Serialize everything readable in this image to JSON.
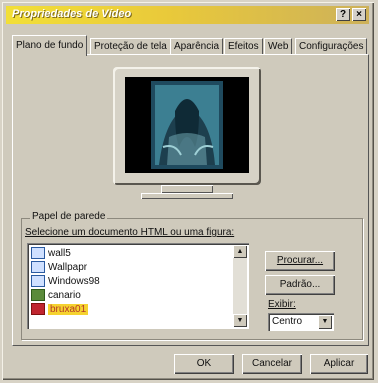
{
  "window": {
    "title": "Propriedades de Vídeo",
    "help_button": "?",
    "close_button": "×"
  },
  "tabs": [
    {
      "label": "Plano de fundo",
      "active": true
    },
    {
      "label": "Proteção de tela",
      "active": false
    },
    {
      "label": "Aparência",
      "active": false
    },
    {
      "label": "Efeitos",
      "active": false
    },
    {
      "label": "Web",
      "active": false
    },
    {
      "label": "Configurações",
      "active": false
    }
  ],
  "wallpaper": {
    "group_label": "Papel de parede",
    "instruction": "Selecione um documento HTML ou uma figura:",
    "items": [
      {
        "label": "wall5",
        "selected": false
      },
      {
        "label": "Wallpapr",
        "selected": false
      },
      {
        "label": "Windows98",
        "selected": false
      },
      {
        "label": "canario",
        "selected": false
      },
      {
        "label": "bruxa01",
        "selected": true
      }
    ],
    "browse_button": "Procurar...",
    "pattern_button": "Padrão...",
    "display_label": "Exibir:",
    "display_value": "Centro"
  },
  "footer": {
    "ok": "OK",
    "cancel": "Cancelar",
    "apply": "Aplicar"
  },
  "colors": {
    "title_gradient_start": "#f2df37",
    "selection_highlight": "#f5d22f"
  }
}
